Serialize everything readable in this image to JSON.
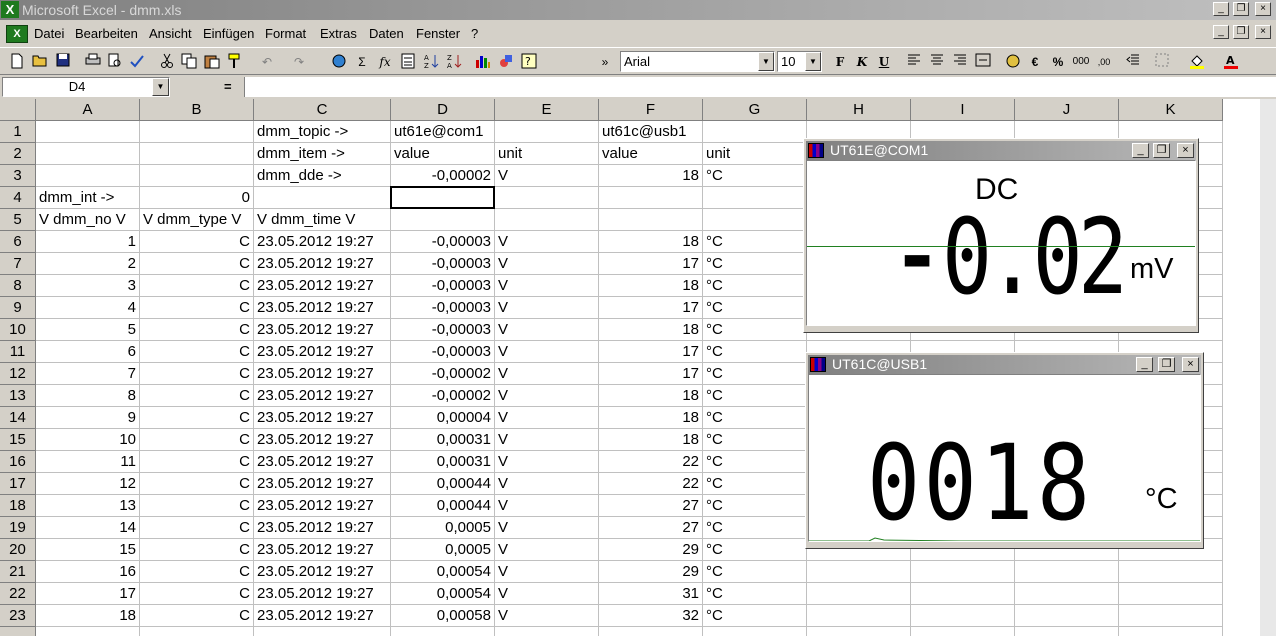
{
  "app": {
    "title": "Microsoft Excel - dmm.xls",
    "logo_glyph": "X",
    "doc_glyph": "X"
  },
  "window_controls": {
    "minimize": "_",
    "restore": "❐",
    "close": "×"
  },
  "menu": [
    "Datei",
    "Bearbeiten",
    "Ansicht",
    "Einfügen",
    "Format",
    "Extras",
    "Daten",
    "Fenster",
    "?"
  ],
  "toolbar": {
    "font_name": "Arial",
    "font_size": "10",
    "bold": "F",
    "italic": "K",
    "underline": "U",
    "sum": "Σ",
    "fx": "fx",
    "currency": "€",
    "percent": "%",
    "thousands": "000",
    "decimals": ",00"
  },
  "formula_bar": {
    "name_box": "D4",
    "equals": "=",
    "content": ""
  },
  "columns": [
    "A",
    "B",
    "C",
    "D",
    "E",
    "F",
    "G",
    "H",
    "I",
    "J",
    "K"
  ],
  "rows": [
    {
      "n": "1",
      "A": "",
      "B": "",
      "C": "dmm_topic ->",
      "D": "ut61e@com1",
      "E": "",
      "F": "ut61c@usb1",
      "G": ""
    },
    {
      "n": "2",
      "A": "",
      "B": "",
      "C": "dmm_item ->",
      "D": "value",
      "E": "unit",
      "F": "value",
      "G": "unit"
    },
    {
      "n": "3",
      "A": "",
      "B": "",
      "C": "dmm_dde ->",
      "D": "-0,00002",
      "E": "V",
      "F": "18",
      "G": "°C"
    },
    {
      "n": "4",
      "A": "dmm_int ->",
      "B": "0",
      "C": "",
      "D": "",
      "E": "",
      "F": "",
      "G": ""
    },
    {
      "n": "5",
      "A": "V dmm_no V",
      "B": "V dmm_type V",
      "C": "V dmm_time V",
      "D": "",
      "E": "",
      "F": "",
      "G": ""
    },
    {
      "n": "6",
      "A": "1",
      "B": "C",
      "C": "23.05.2012 19:27",
      "D": "-0,00003",
      "E": "V",
      "F": "18",
      "G": "°C"
    },
    {
      "n": "7",
      "A": "2",
      "B": "C",
      "C": "23.05.2012 19:27",
      "D": "-0,00003",
      "E": "V",
      "F": "17",
      "G": "°C"
    },
    {
      "n": "8",
      "A": "3",
      "B": "C",
      "C": "23.05.2012 19:27",
      "D": "-0,00003",
      "E": "V",
      "F": "18",
      "G": "°C"
    },
    {
      "n": "9",
      "A": "4",
      "B": "C",
      "C": "23.05.2012 19:27",
      "D": "-0,00003",
      "E": "V",
      "F": "17",
      "G": "°C"
    },
    {
      "n": "10",
      "A": "5",
      "B": "C",
      "C": "23.05.2012 19:27",
      "D": "-0,00003",
      "E": "V",
      "F": "18",
      "G": "°C"
    },
    {
      "n": "11",
      "A": "6",
      "B": "C",
      "C": "23.05.2012 19:27",
      "D": "-0,00003",
      "E": "V",
      "F": "17",
      "G": "°C"
    },
    {
      "n": "12",
      "A": "7",
      "B": "C",
      "C": "23.05.2012 19:27",
      "D": "-0,00002",
      "E": "V",
      "F": "17",
      "G": "°C"
    },
    {
      "n": "13",
      "A": "8",
      "B": "C",
      "C": "23.05.2012 19:27",
      "D": "-0,00002",
      "E": "V",
      "F": "18",
      "G": "°C"
    },
    {
      "n": "14",
      "A": "9",
      "B": "C",
      "C": "23.05.2012 19:27",
      "D": "0,00004",
      "E": "V",
      "F": "18",
      "G": "°C"
    },
    {
      "n": "15",
      "A": "10",
      "B": "C",
      "C": "23.05.2012 19:27",
      "D": "0,00031",
      "E": "V",
      "F": "18",
      "G": "°C"
    },
    {
      "n": "16",
      "A": "11",
      "B": "C",
      "C": "23.05.2012 19:27",
      "D": "0,00031",
      "E": "V",
      "F": "22",
      "G": "°C"
    },
    {
      "n": "17",
      "A": "12",
      "B": "C",
      "C": "23.05.2012 19:27",
      "D": "0,00044",
      "E": "V",
      "F": "22",
      "G": "°C"
    },
    {
      "n": "18",
      "A": "13",
      "B": "C",
      "C": "23.05.2012 19:27",
      "D": "0,00044",
      "E": "V",
      "F": "27",
      "G": "°C"
    },
    {
      "n": "19",
      "A": "14",
      "B": "C",
      "C": "23.05.2012 19:27",
      "D": "0,0005",
      "E": "V",
      "F": "27",
      "G": "°C"
    },
    {
      "n": "20",
      "A": "15",
      "B": "C",
      "C": "23.05.2012 19:27",
      "D": "0,0005",
      "E": "V",
      "F": "29",
      "G": "°C"
    },
    {
      "n": "21",
      "A": "16",
      "B": "C",
      "C": "23.05.2012 19:27",
      "D": "0,00054",
      "E": "V",
      "F": "29",
      "G": "°C"
    },
    {
      "n": "22",
      "A": "17",
      "B": "C",
      "C": "23.05.2012 19:27",
      "D": "0,00054",
      "E": "V",
      "F": "31",
      "G": "°C"
    },
    {
      "n": "23",
      "A": "18",
      "B": "C",
      "C": "23.05.2012 19:27",
      "D": "0,00058",
      "E": "V",
      "F": "32",
      "G": "°C"
    }
  ],
  "right_aligned_cols": [
    "A",
    "B",
    "D",
    "F"
  ],
  "text_aligned_override": {
    "A": [
      "4",
      "5"
    ],
    "B": [
      "5"
    ]
  },
  "dmm1": {
    "title": "UT61E@COM1",
    "mode": "DC",
    "sign": "-",
    "reading": "0.02",
    "unit": "mV",
    "line_color": "#208020"
  },
  "dmm2": {
    "title": "UT61C@USB1",
    "reading": "0018",
    "unit": "°C",
    "line_color": "#208020"
  }
}
